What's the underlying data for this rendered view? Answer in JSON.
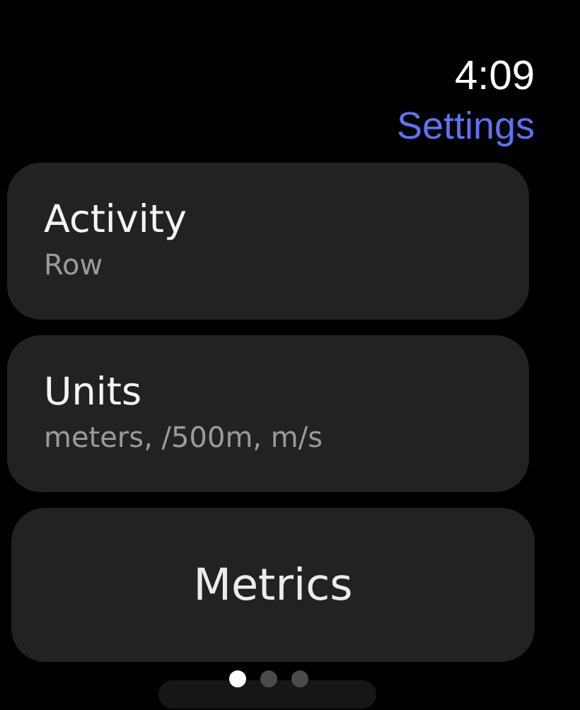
{
  "status_bar": {
    "time": "4:09"
  },
  "header": {
    "title": "Settings"
  },
  "items": [
    {
      "kind": "detail",
      "title": "Activity",
      "subtitle": "Row"
    },
    {
      "kind": "detail",
      "title": "Units",
      "subtitle": "meters, /500m, m/s"
    },
    {
      "kind": "button",
      "title": "Metrics"
    }
  ],
  "page_indicator": [
    {
      "selected": true
    },
    {
      "selected": false
    },
    {
      "selected": false
    }
  ]
}
